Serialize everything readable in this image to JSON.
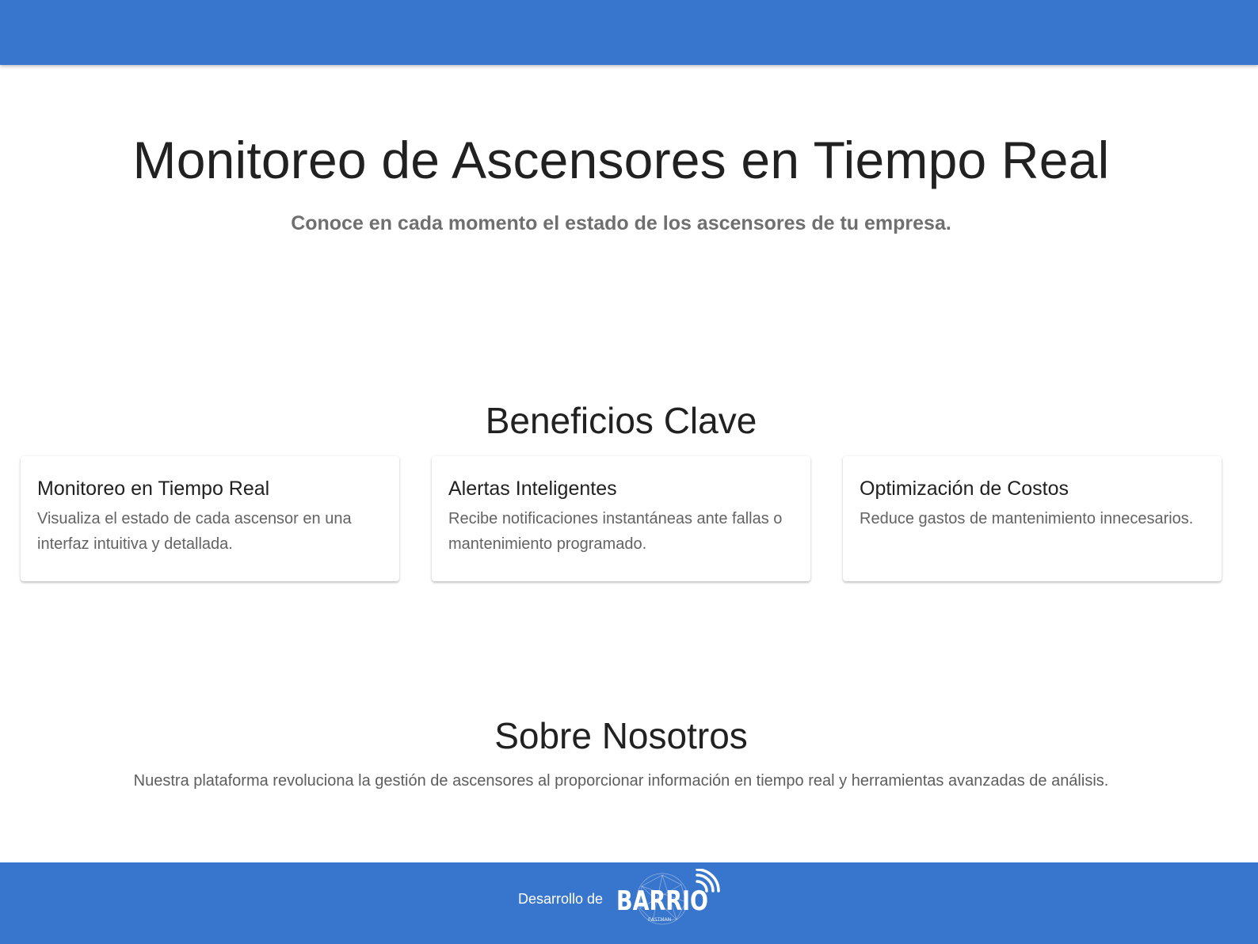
{
  "hero": {
    "title": "Monitoreo de Ascensores en Tiempo Real",
    "subtitle": "Conoce en cada momento el estado de los ascensores de tu empresa."
  },
  "benefits": {
    "title": "Beneficios Clave",
    "cards": [
      {
        "title": "Monitoreo en Tiempo Real",
        "text": "Visualiza el estado de cada ascensor en una interfaz intuitiva y detallada."
      },
      {
        "title": "Alertas Inteligentes",
        "text": "Recibe notificaciones instantáneas ante fallas o mantenimiento programado."
      },
      {
        "title": "Optimización de Costos",
        "text": "Reduce gastos de mantenimiento innecesarios."
      }
    ]
  },
  "about": {
    "title": "Sobre Nosotros",
    "text": "Nuestra plataforma revoluciona la gestión de ascensores al proporcionar información en tiempo real y herramientas avanzadas de análisis."
  },
  "footer": {
    "label": "Desarrollo de",
    "logo_text": "BARRIO",
    "logo_subtext": "EASTMAN",
    "logo_icon": "wifi-signal-icon"
  },
  "colors": {
    "primary": "#3875cc",
    "background": "#ffffff",
    "heading": "#212121",
    "muted": "#6f6f6f"
  }
}
